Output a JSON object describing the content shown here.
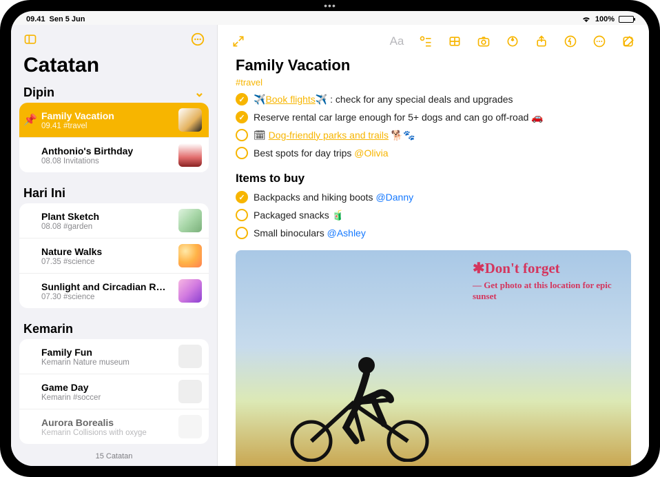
{
  "status": {
    "time": "09.41",
    "date": "Sen 5 Jun",
    "battery": "100%"
  },
  "sidebar": {
    "title": "Catatan",
    "sections": [
      {
        "header": "Dipin",
        "items": [
          {
            "title": "Family Vacation",
            "sub": "09.41  #travel",
            "pinned": true,
            "selected": true,
            "thumb": "t1"
          },
          {
            "title": "Anthonio's Birthday",
            "sub": "08.08  Invitations",
            "thumb": "t2"
          }
        ]
      },
      {
        "header": "Hari Ini",
        "items": [
          {
            "title": "Plant Sketch",
            "sub": "08.08  #garden",
            "thumb": "t3"
          },
          {
            "title": "Nature Walks",
            "sub": "07.35  #science",
            "thumb": "t4"
          },
          {
            "title": "Sunlight and Circadian Rhy…",
            "sub": "07.30  #science",
            "thumb": "t5"
          }
        ]
      },
      {
        "header": "Kemarin",
        "items": [
          {
            "title": "Family Fun",
            "sub": "Kemarin  Nature museum",
            "thumb": "t6"
          },
          {
            "title": "Game Day",
            "sub": "Kemarin  #soccer",
            "thumb": "t6"
          },
          {
            "title": "Aurora Borealis",
            "sub": "Kemarin  Collisions with oxyge",
            "thumb": "t6"
          }
        ]
      }
    ],
    "footer": "15 Catatan"
  },
  "note": {
    "title": "Family Vacation",
    "tag": "#travel",
    "checks1": [
      {
        "done": true,
        "pre": "✈️",
        "link": "Book flights",
        "post": "✈️ : check for any special deals and upgrades"
      },
      {
        "done": true,
        "text": "Reserve rental car large enough for 5+ dogs and can go off-road 🚗"
      },
      {
        "done": false,
        "pre": "🗓",
        "link": "Dog-friendly parks and trails",
        "post": " 🐕🐾"
      },
      {
        "done": false,
        "text": "Best spots for day trips ",
        "mention": "@Olivia"
      }
    ],
    "section2": "Items to buy",
    "checks2": [
      {
        "done": true,
        "text": "Backpacks and hiking boots ",
        "bmention": "@Danny"
      },
      {
        "done": false,
        "text": "Packaged snacks 🧃"
      },
      {
        "done": false,
        "text": "Small binoculars ",
        "bmention": "@Ashley"
      }
    ],
    "hand": {
      "big": "✱Don't forget",
      "small": "— Get photo at this location for epic sunset"
    }
  }
}
